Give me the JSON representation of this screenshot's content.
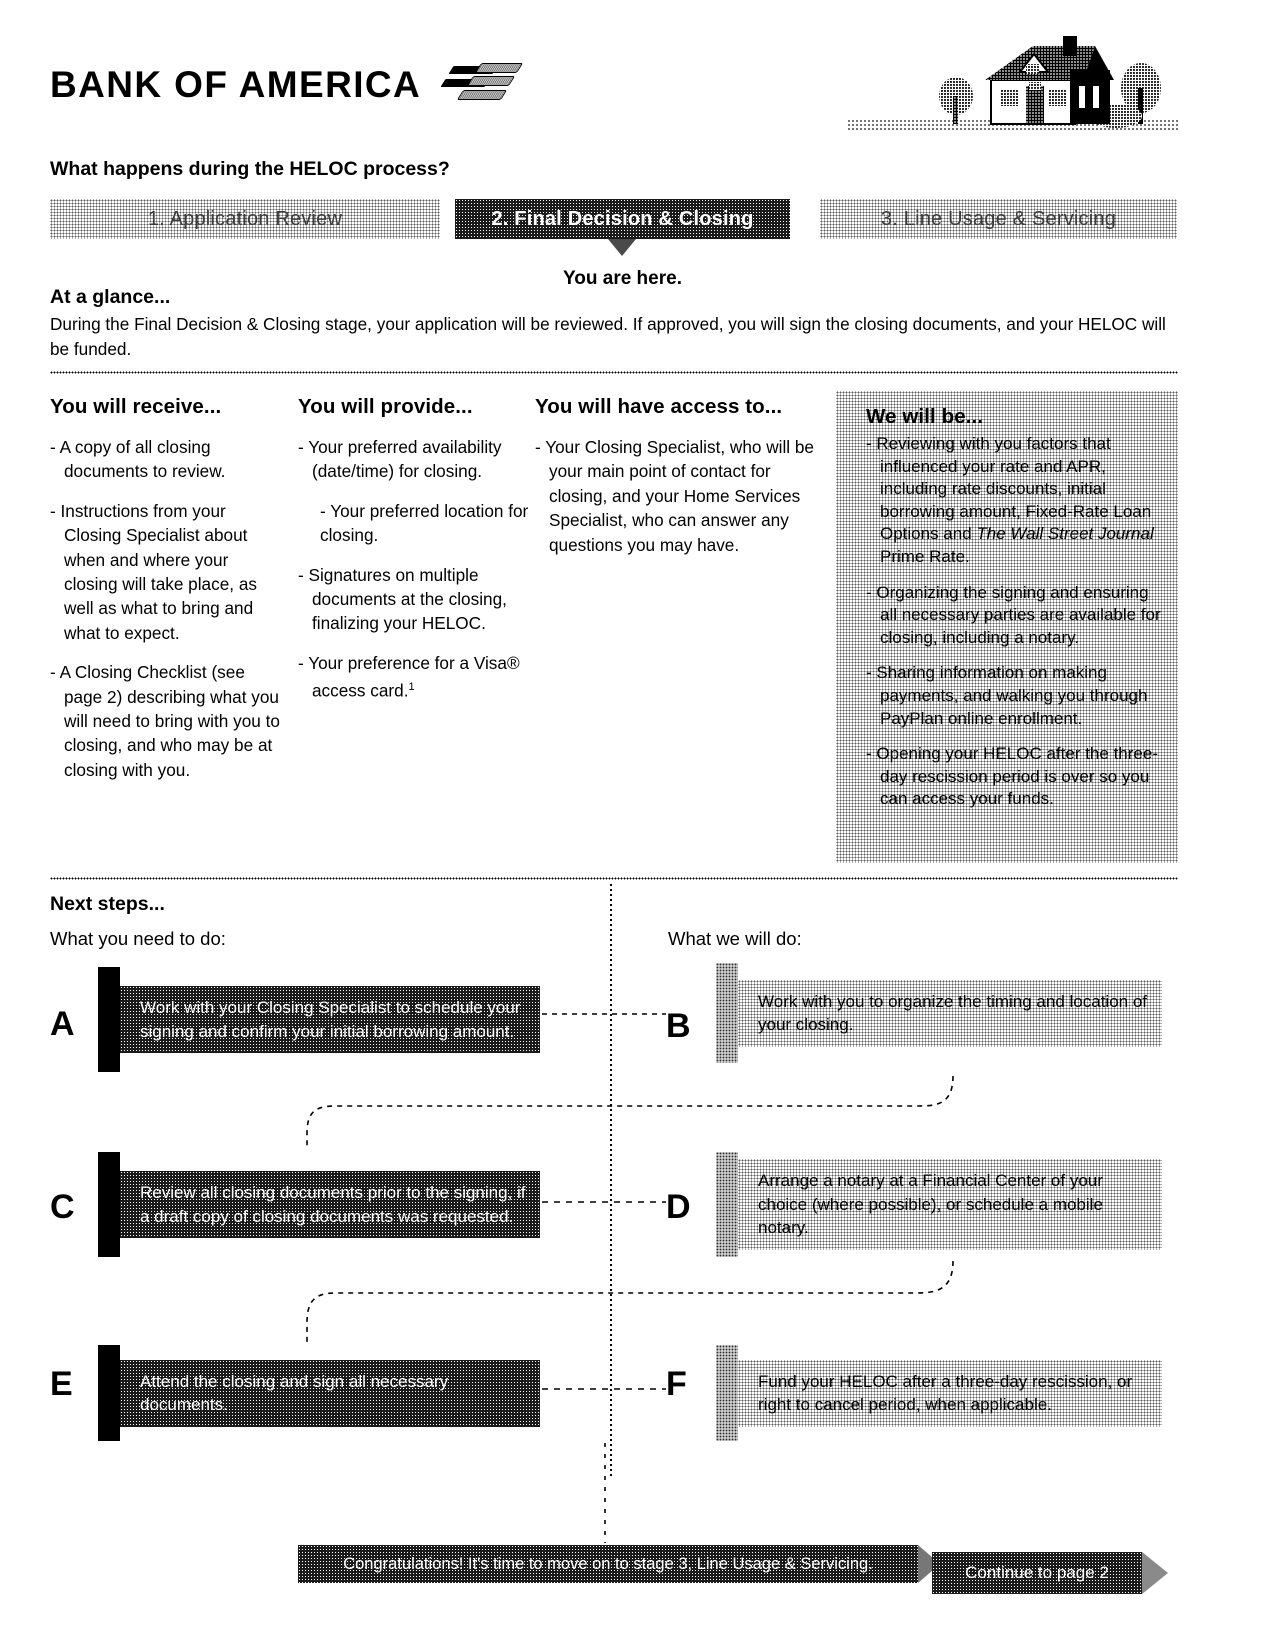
{
  "brand": {
    "name": "BANK OF AMERICA",
    "logo_icon": "bank-of-america-flag-logo",
    "house_icon": "house-illustration"
  },
  "header": {
    "question": "What happens during the HELOC process?"
  },
  "stages": [
    {
      "label": "1. Application Review",
      "active": false
    },
    {
      "label": "2. Final Decision & Closing",
      "active": true
    },
    {
      "label": "3. Line Usage & Servicing",
      "active": false
    }
  ],
  "you_are_here": "You are here.",
  "at_a_glance": {
    "title": "At a glance...",
    "body": "During the Final Decision & Closing stage, your application will be reviewed. If approved, you will sign the closing documents, and your HELOC will be funded."
  },
  "columns": {
    "receive": {
      "title": "You will receive...",
      "items": [
        "A copy of all closing documents to review.",
        "Instructions from your Closing Specialist about when and where your closing will take place, as well as what to bring and what to expect.",
        "A Closing Checklist (see page 2) describing what you will need to bring with you to closing, and who may be at closing with you."
      ]
    },
    "provide": {
      "title": "You will provide...",
      "items": [
        "Your preferred availability (date/time) for closing.",
        "- Your preferred location for closing.",
        "Signatures on multiple documents at the closing, finalizing your HELOC.",
        "Your preference for a Visa® access card."
      ],
      "footnote_marker": "1"
    },
    "access": {
      "title": "You will have access to...",
      "items": [
        "Your Closing Specialist, who will be your main point of contact for closing, and your Home Services Specialist, who can answer any questions you may have."
      ]
    },
    "we_will_be": {
      "title": "We will be...",
      "items": [
        {
          "pre": "Reviewing with you factors that influenced your rate and APR, including rate discounts, initial borrowing amount, Fixed-Rate Loan Options and ",
          "italic": "The Wall Street Journal",
          "post": " Prime Rate."
        },
        {
          "pre": "Organizing the signing and ensuring all necessary parties are available for closing, including a notary.",
          "italic": "",
          "post": ""
        },
        {
          "pre": "Sharing information on making payments, and walking you through PayPlan online enrollment.",
          "italic": "",
          "post": ""
        },
        {
          "pre": "Opening your HELOC after the three-day rescission period is over so you can access your funds.",
          "italic": "",
          "post": ""
        }
      ]
    }
  },
  "next_steps": {
    "title": "Next steps...",
    "you_label": "What you need to do:",
    "we_label": "What we will do:",
    "steps": [
      {
        "letter": "A",
        "side": "you",
        "text": "Work with your Closing Specialist to schedule your signing and confirm your initial borrowing amount."
      },
      {
        "letter": "B",
        "side": "we",
        "text": "Work with you to organize the timing and location of your closing."
      },
      {
        "letter": "C",
        "side": "you",
        "text": "Review all closing documents prior to the signing, if a draft copy of closing documents was requested."
      },
      {
        "letter": "D",
        "side": "we",
        "text": "Arrange a notary at a Financial Center of your choice (where possible), or schedule a mobile notary."
      },
      {
        "letter": "E",
        "side": "you",
        "text": "Attend the closing and sign all necessary documents."
      },
      {
        "letter": "F",
        "side": "we",
        "text": "Fund your HELOC after a three-day rescission, or right to cancel period, when applicable."
      }
    ]
  },
  "footer": {
    "congratulations": "Congratulations! It's time to move on to stage 3, Line Usage & Servicing.",
    "continue_label": "Continue to page 2",
    "continue_icon": "arrow-right-icon"
  },
  "colors": {
    "active_stage": "#4a4a4a",
    "inactive_stage": "#d9d9d9",
    "dark_box": "#4d4d4d",
    "light_box": "#d8d8d8",
    "accent": "#000000"
  }
}
